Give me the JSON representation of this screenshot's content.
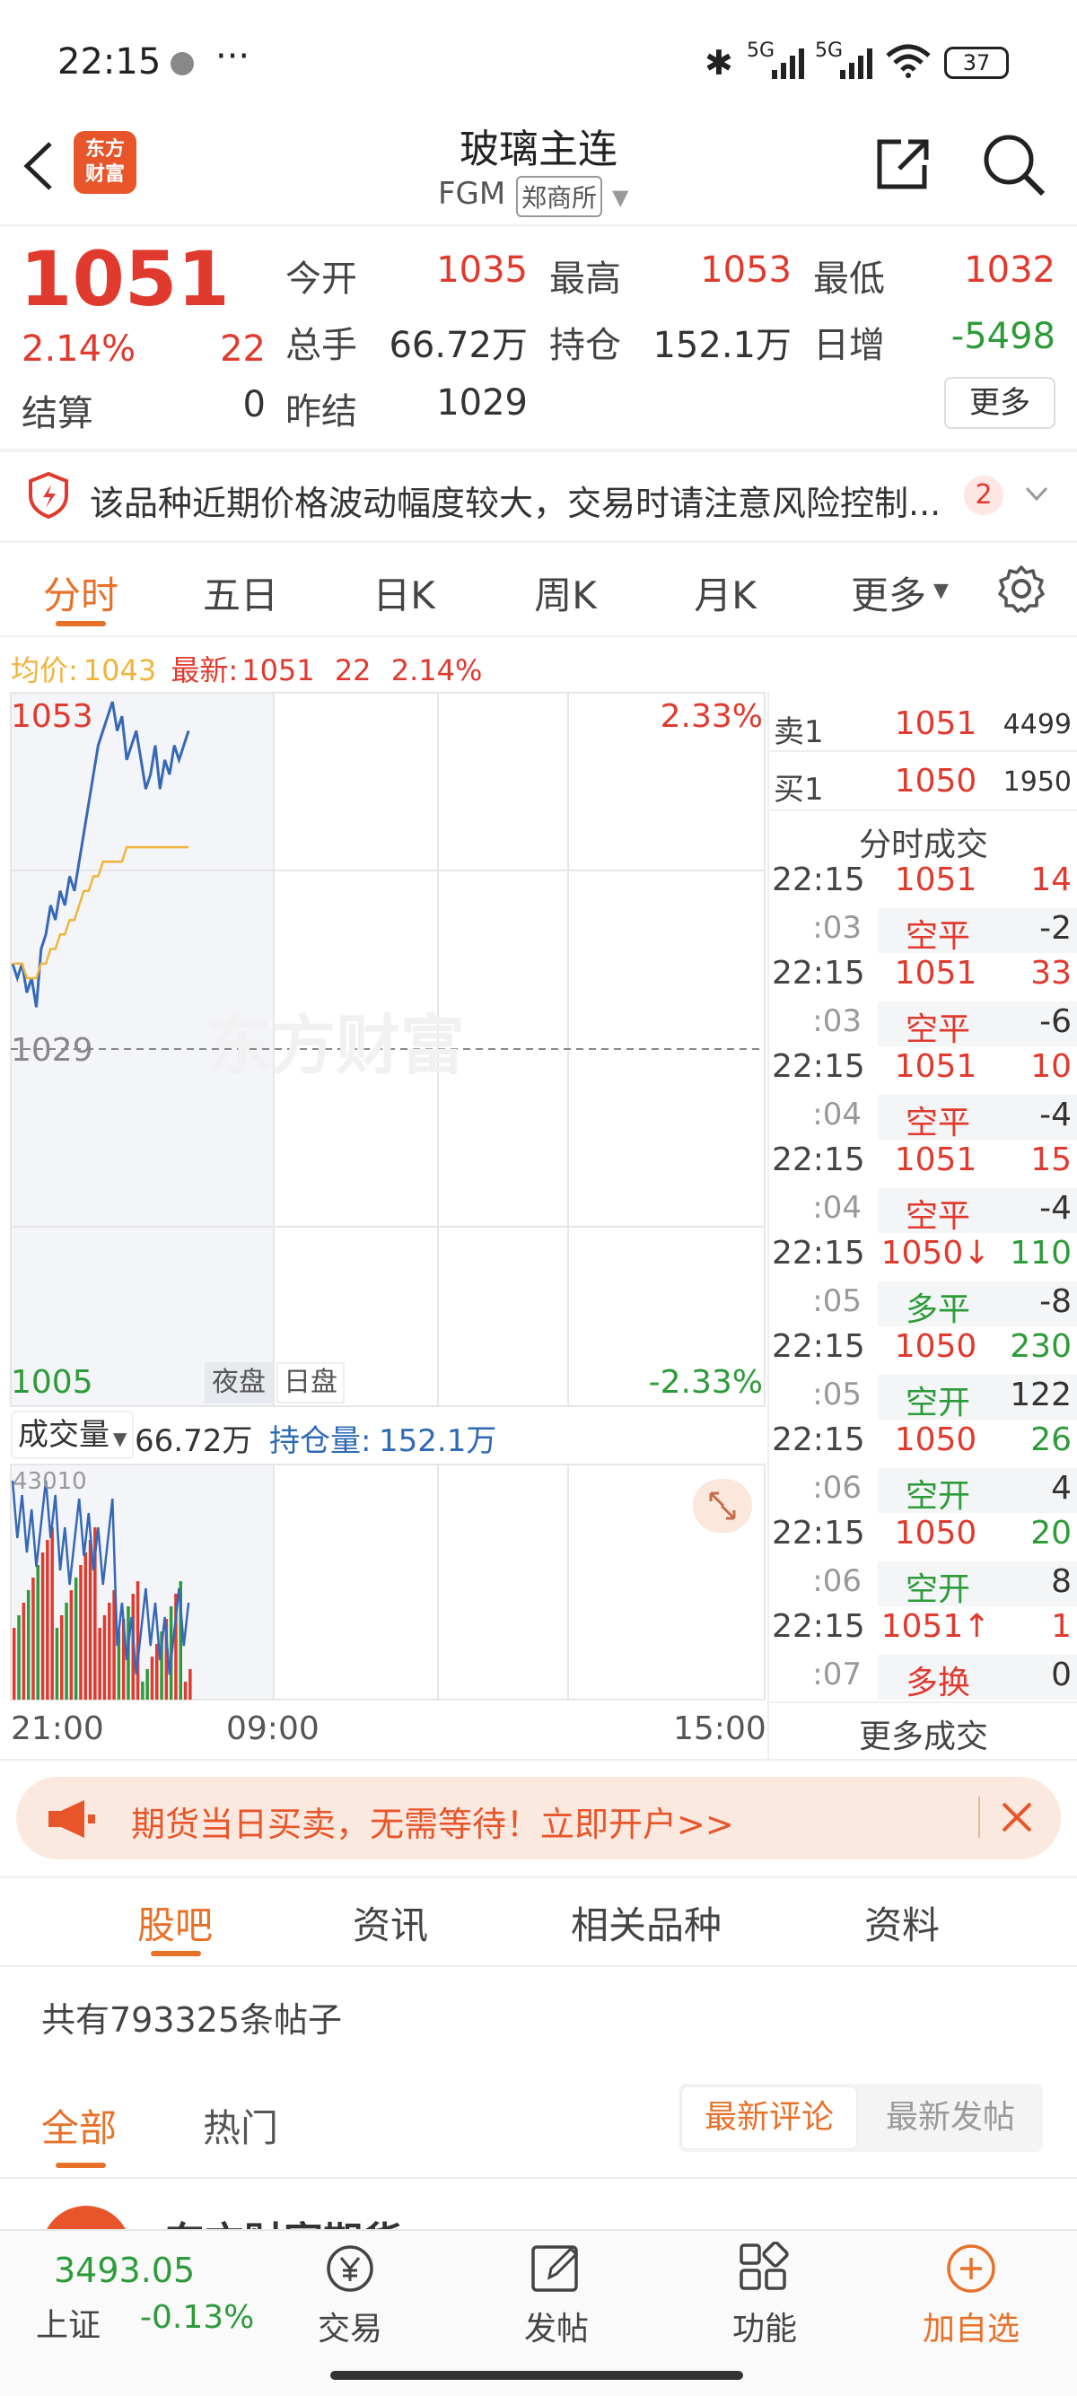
{
  "status_bar": {
    "time": "22:15",
    "battery": "37",
    "signal1": "5G",
    "signal2": "5G"
  },
  "header": {
    "logo_text": "东方\n财富",
    "title": "玻璃主连",
    "code": "FGM",
    "exchange": "郑商所"
  },
  "quote": {
    "price": "1051",
    "change_pct": "2.14%",
    "change": "22",
    "rows": [
      [
        {
          "label": "今开",
          "value": "1035"
        },
        {
          "label": "最高",
          "value": "1053"
        },
        {
          "label": "最低",
          "value": "1032"
        }
      ],
      [
        {
          "label": "总手",
          "value": "66.72万"
        },
        {
          "label": "持仓",
          "value": "152.1万"
        },
        {
          "label": "日增",
          "value": "-5498"
        }
      ]
    ],
    "settle_label": "结算",
    "settle_value": "0",
    "prev_settle_label": "昨结",
    "prev_settle_value": "1029",
    "more_button": "更多"
  },
  "risk_notice": {
    "text": "该品种近期价格波动幅度较大，交易时请注意风险控制...",
    "badge": "2"
  },
  "tabs": [
    "分时",
    "五日",
    "日K",
    "周K",
    "月K",
    "更多"
  ],
  "chart_info": {
    "avg_label": "均价:",
    "avg_value": "1043",
    "latest_label": "最新:",
    "latest_value": "1051",
    "latest_change": "22",
    "latest_pct": "2.14%"
  },
  "chart_data": {
    "type": "line",
    "y_max": "1053",
    "y_min": "1005",
    "y_ref": "1029",
    "pct_max": "2.33%",
    "pct_min": "-2.33%",
    "x_ticks": [
      "21:00",
      "09:00",
      "15:00"
    ],
    "session_labels": [
      "夜盘",
      "日盘"
    ],
    "ylim": [
      1005,
      1053
    ],
    "series": [
      {
        "values": [
          1035,
          1034,
          1035,
          1033,
          1034,
          1032,
          1036,
          1037,
          1039,
          1038,
          1040,
          1039,
          1041,
          1040,
          1042,
          1044,
          1046,
          1048,
          1050,
          1051,
          1052,
          1053,
          1051,
          1052,
          1049,
          1050,
          1051,
          1049,
          1047,
          1048,
          1050,
          1047,
          1049,
          1048,
          1050,
          1049,
          1050,
          1051
        ]
      },
      {
        "values": [
          1035,
          1035,
          1035,
          1034,
          1034,
          1034,
          1035,
          1035,
          1036,
          1036,
          1037,
          1037,
          1038,
          1038,
          1039,
          1040,
          1040,
          1041,
          1041,
          1042,
          1042,
          1042,
          1042,
          1042,
          1043,
          1043,
          1043,
          1043,
          1043,
          1043,
          1043,
          1043,
          1043,
          1043,
          1043,
          1043,
          1043,
          1043
        ]
      }
    ]
  },
  "volume": {
    "label": "成交量",
    "value": "66.72万",
    "oi_label": "持仓量:",
    "oi_value": "152.1万",
    "y_max": "43010"
  },
  "order_book": {
    "sell": {
      "label": "卖1",
      "price": "1051",
      "volume": "4499"
    },
    "buy": {
      "label": "买1",
      "price": "1050",
      "volume": "1950"
    },
    "title": "分时成交"
  },
  "trades": [
    {
      "time": "22:15",
      "price": "1051",
      "vol": "14",
      "sec": ":03",
      "type": "空平",
      "delta": "-2",
      "pc": "red",
      "vc": "red",
      "tc": "red"
    },
    {
      "time": "22:15",
      "price": "1051",
      "vol": "33",
      "sec": ":03",
      "type": "空平",
      "delta": "-6",
      "pc": "red",
      "vc": "red",
      "tc": "red"
    },
    {
      "time": "22:15",
      "price": "1051",
      "vol": "10",
      "sec": ":04",
      "type": "空平",
      "delta": "-4",
      "pc": "red",
      "vc": "red",
      "tc": "red"
    },
    {
      "time": "22:15",
      "price": "1051",
      "vol": "15",
      "sec": ":04",
      "type": "空平",
      "delta": "-4",
      "pc": "red",
      "vc": "red",
      "tc": "red"
    },
    {
      "time": "22:15",
      "price": "1050↓",
      "vol": "110",
      "sec": ":05",
      "type": "多平",
      "delta": "-8",
      "pc": "red",
      "vc": "green",
      "tc": "green"
    },
    {
      "time": "22:15",
      "price": "1050",
      "vol": "230",
      "sec": ":05",
      "type": "空开",
      "delta": "122",
      "pc": "red",
      "vc": "green",
      "tc": "green"
    },
    {
      "time": "22:15",
      "price": "1050",
      "vol": "26",
      "sec": ":06",
      "type": "空开",
      "delta": "4",
      "pc": "red",
      "vc": "green",
      "tc": "green"
    },
    {
      "time": "22:15",
      "price": "1050",
      "vol": "20",
      "sec": ":06",
      "type": "空开",
      "delta": "8",
      "pc": "red",
      "vc": "green",
      "tc": "green"
    },
    {
      "time": "22:15",
      "price": "1051↑",
      "vol": "1",
      "sec": ":07",
      "type": "多换",
      "delta": "0",
      "pc": "red",
      "vc": "red",
      "tc": "red"
    }
  ],
  "more_trades": "更多成交",
  "banner": {
    "text": "期货当日买卖，无需等待！立即开户>>"
  },
  "community_tabs": [
    "股吧",
    "资讯",
    "相关品种",
    "资料"
  ],
  "post_count": "共有793325条帖子",
  "filter_tabs": [
    "全部",
    "热门"
  ],
  "sort_buttons": [
    "最新评论",
    "最新发帖"
  ],
  "post_preview_author": "东方财富期货",
  "bottom_nav": {
    "index_value": "3493.05",
    "index_name": "上证",
    "index_change": "-0.13%",
    "items": [
      "交易",
      "发帖",
      "功能",
      "加自选"
    ]
  },
  "colors": {
    "up": "#e03a2f",
    "down": "#2e9b3a",
    "accent": "#e8712a",
    "price_line": "#3768b8",
    "avg_line": "#f0b43c"
  }
}
